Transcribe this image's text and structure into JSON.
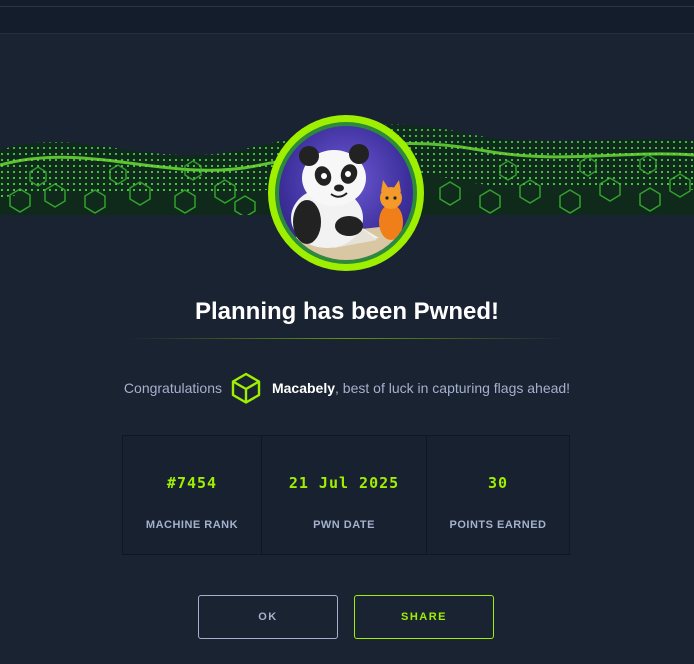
{
  "colors": {
    "accent": "#9fef00",
    "background": "#1a2332",
    "muted_text": "#a4b1cd"
  },
  "header": {
    "title": "Planning has been Pwned!"
  },
  "congrats": {
    "prefix": "Congratulations",
    "username": "Macabely",
    "suffix": ", best of luck in capturing flags ahead!",
    "icon": "cube-icon"
  },
  "stats": [
    {
      "value": "#7454",
      "label": "MACHINE RANK"
    },
    {
      "value": "21 Jul 2025",
      "label": "PWN DATE"
    },
    {
      "value": "30",
      "label": "POINTS EARNED"
    }
  ],
  "actions": {
    "ok_label": "OK",
    "share_label": "SHARE"
  }
}
